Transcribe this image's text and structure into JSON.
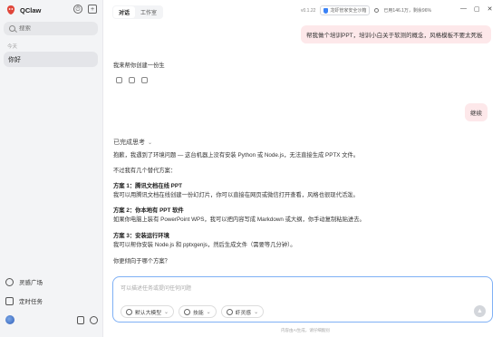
{
  "app": {
    "name": "QClaw"
  },
  "sidebar": {
    "search_placeholder": "搜索",
    "section_today": "今天",
    "conversation": "你好",
    "menu": [
      {
        "label": "灵感广场",
        "icon": "bulb-icon"
      },
      {
        "label": "定时任务",
        "icon": "clock-icon"
      }
    ],
    "new_chat_icon": "+",
    "history_icon": "⏱"
  },
  "header": {
    "tabs": [
      "对话",
      "工作室"
    ],
    "version": "v0.1.22",
    "security_badge": "龙虾管家安全沙箱",
    "quota": "已用146.1万，剩余96%",
    "min": "—",
    "max": "▢",
    "close": "✕"
  },
  "chat": {
    "user_msg_1": "帮我做个培训PPT，培训小白关于软测的概念，风格模板不要太死板",
    "ai_reply_1": "我来帮你创建一份生",
    "user_msg_2": "继续",
    "thinking_label": "已完成思考",
    "p1": "抱歉，我遇到了环境问题 — 这台机器上没有安装 Python 或 Node.js，无法直接生成 PPTX 文件。",
    "p2": "不过我有几个替代方案：",
    "opt1_title": "方案 1：腾讯文档在线 PPT",
    "opt1_text": "我可以用腾讯文档在线创建一份幻灯片，你可以直接在网页或微信打开查看，风格也很现代活泼。",
    "opt2_title": "方案 2：你本地有 PPT 软件",
    "opt2_text": "如果你电脑上装有 PowerPoint WPS，我可以把内容写成 Markdown 或大纲，你手动复制粘贴进去。",
    "opt3_title": "方案 3：安装运行环境",
    "opt3_text": "我可以帮你安装 Node.js 和 pptxgenjs，然后生成文件（需要等几分钟）。",
    "question": "你更倾向于哪个方案？"
  },
  "composer": {
    "placeholder": "可以描述任务或提问任何问题",
    "chips": [
      "默认大模型",
      "技能",
      "虾灵感"
    ],
    "send_icon": "▲",
    "footnote": "内容由AI生成，请仔细甄别"
  },
  "colors": {
    "accent": "#3b82f6",
    "user_bubble": "#fde8ea",
    "sidebar_bg": "#f3f4f6"
  }
}
